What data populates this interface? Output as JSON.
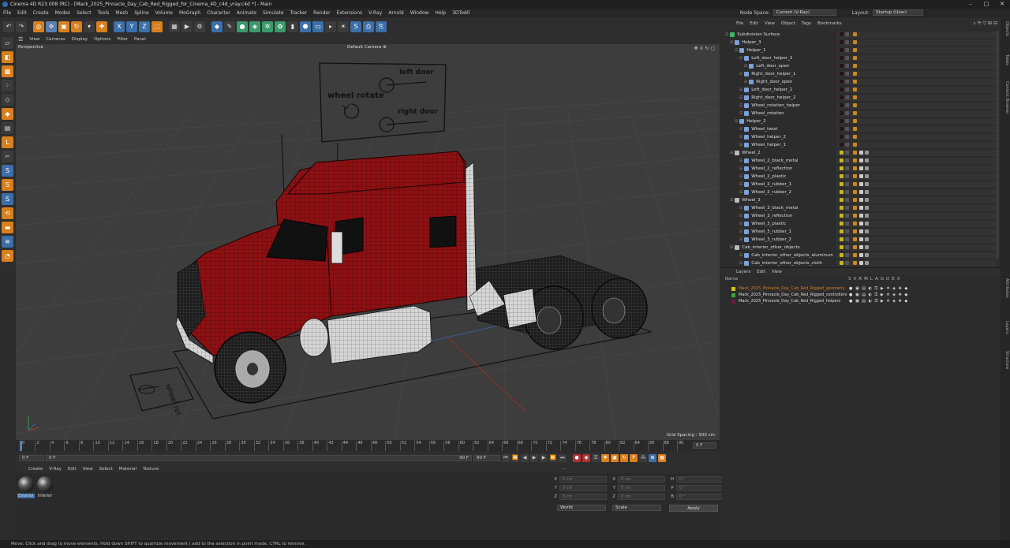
{
  "window": {
    "title": "Cinema 4D R23.008 (RC) - [Mack_2025_Pinnacle_Day_Cab_Red_Rigged_for_Cinema_4D_c4d_vray.c4d *] - Main"
  },
  "menubar": [
    "File",
    "Edit",
    "Create",
    "Modes",
    "Select",
    "Tools",
    "Mesh",
    "Spline",
    "Volume",
    "MoGraph",
    "Character",
    "Animate",
    "Simulate",
    "Tracker",
    "Render",
    "Extensions",
    "V-Ray",
    "Arnold",
    "Window",
    "Help",
    "3DToAll"
  ],
  "node_space": {
    "label": "Node Space:",
    "value": "Current (V-Ray)"
  },
  "layout": {
    "label": "Layout:",
    "value": "Startup (User)"
  },
  "viewport": {
    "menu": [
      "View",
      "Cameras",
      "Display",
      "Options",
      "Filter",
      "Panel"
    ],
    "view_name": "Perspective",
    "camera": "Default Camera",
    "grid_spacing": "Grid Spacing : 500 cm",
    "rig_labels": {
      "wheel_rotate": "wheel rotate",
      "left_door": "left door",
      "right_door": "right door",
      "floor_label": "wheel rot"
    }
  },
  "timeline": {
    "ticks": [
      "0",
      "2",
      "4",
      "6",
      "8",
      "10",
      "12",
      "14",
      "16",
      "18",
      "20",
      "22",
      "24",
      "26",
      "28",
      "30",
      "32",
      "34",
      "36",
      "38",
      "40",
      "42",
      "44",
      "46",
      "48",
      "50",
      "52",
      "54",
      "56",
      "58",
      "60",
      "62",
      "64",
      "66",
      "68",
      "70",
      "72",
      "74",
      "76",
      "78",
      "80",
      "82",
      "84",
      "86",
      "88",
      "90"
    ],
    "current_frame": "0 F"
  },
  "playbar": {
    "start": "0 F",
    "field2": "0 F",
    "end": "90 F",
    "end2": "90 F"
  },
  "materials": {
    "menu": [
      "Create",
      "V-Ray",
      "Edit",
      "View",
      "Select",
      "Material",
      "Texture"
    ],
    "items": [
      {
        "name": "Exterior",
        "selected": true
      },
      {
        "name": "Interior",
        "selected": false
      }
    ]
  },
  "attributes": {
    "rows": [
      {
        "a": "X",
        "av": "0 cm",
        "b": "X",
        "bv": "0 cm",
        "c": "H",
        "cv": "0 °"
      },
      {
        "a": "Y",
        "av": "0 cm",
        "b": "Y",
        "bv": "0 cm",
        "c": "P",
        "cv": "0 °"
      },
      {
        "a": "Z",
        "av": "0 cm",
        "b": "Z",
        "bv": "0 cm",
        "c": "B",
        "cv": "0 °"
      }
    ],
    "coord_mode": "World",
    "scale_mode": "Scale",
    "apply": "Apply"
  },
  "objects": {
    "menu": [
      "File",
      "Edit",
      "View",
      "Object",
      "Tags",
      "Bookmarks"
    ],
    "items": [
      {
        "name": "Subdivision Surface",
        "depth": 0,
        "color": "#3bb86a"
      },
      {
        "name": "Helper_3",
        "depth": 1,
        "color": "#7aa3d6"
      },
      {
        "name": "Helper_1",
        "depth": 2,
        "color": "#7aa3d6"
      },
      {
        "name": "Left_door_helper_2",
        "depth": 3,
        "color": "#7aa3d6"
      },
      {
        "name": "Left_door_open",
        "depth": 4,
        "color": "#7aa3d6"
      },
      {
        "name": "Right_door_helper_1",
        "depth": 3,
        "color": "#7aa3d6"
      },
      {
        "name": "Right_door_open",
        "depth": 4,
        "color": "#7aa3d6"
      },
      {
        "name": "Left_door_helper_1",
        "depth": 3,
        "color": "#7aa3d6"
      },
      {
        "name": "Right_door_helper_2",
        "depth": 3,
        "color": "#7aa3d6"
      },
      {
        "name": "Wheel_rotation_helper",
        "depth": 3,
        "color": "#7aa3d6"
      },
      {
        "name": "Wheel_rotation",
        "depth": 3,
        "color": "#7aa3d6"
      },
      {
        "name": "Helper_2",
        "depth": 2,
        "color": "#7aa3d6"
      },
      {
        "name": "Wheel_twist",
        "depth": 3,
        "color": "#7aa3d6"
      },
      {
        "name": "Wheel_helper_2",
        "depth": 3,
        "color": "#7aa3d6"
      },
      {
        "name": "Wheel_helper_1",
        "depth": 3,
        "color": "#7aa3d6"
      },
      {
        "name": "Wheel_2",
        "depth": 1,
        "color": "#bbbbbb"
      },
      {
        "name": "Wheel_2_black_metal",
        "depth": 3,
        "color": "#7aa3d6"
      },
      {
        "name": "Wheel_2_reflection",
        "depth": 3,
        "color": "#7aa3d6"
      },
      {
        "name": "Wheel_2_plastic",
        "depth": 3,
        "color": "#7aa3d6"
      },
      {
        "name": "Wheel_2_rubber_1",
        "depth": 3,
        "color": "#7aa3d6"
      },
      {
        "name": "Wheel_2_rubber_2",
        "depth": 3,
        "color": "#7aa3d6"
      },
      {
        "name": "Wheel_3",
        "depth": 1,
        "color": "#bbbbbb"
      },
      {
        "name": "Wheel_3_black_metal",
        "depth": 3,
        "color": "#7aa3d6"
      },
      {
        "name": "Wheel_3_reflection",
        "depth": 3,
        "color": "#7aa3d6"
      },
      {
        "name": "Wheel_3_plastic",
        "depth": 3,
        "color": "#7aa3d6"
      },
      {
        "name": "Wheel_3_rubber_1",
        "depth": 3,
        "color": "#7aa3d6"
      },
      {
        "name": "Wheel_3_rubber_2",
        "depth": 3,
        "color": "#7aa3d6"
      },
      {
        "name": "Cab_interior_other_objects",
        "depth": 1,
        "color": "#bbbbbb"
      },
      {
        "name": "Cab_interior_other_objects_aluminum",
        "depth": 3,
        "color": "#7aa3d6"
      },
      {
        "name": "Cab_interior_other_objects_cloth",
        "depth": 3,
        "color": "#7aa3d6"
      }
    ]
  },
  "layers": {
    "menu": [
      "Layers",
      "Edit",
      "View"
    ],
    "header": {
      "name": "Name",
      "cols": [
        "S",
        "V",
        "R",
        "M",
        "L",
        "A",
        "G",
        "D",
        "E",
        "X"
      ]
    },
    "items": [
      {
        "name": "Mack_2025_Pinnacle_Day_Cab_Red_Rigged_geometry",
        "color": "#d4c020",
        "highlight": true
      },
      {
        "name": "Mack_2025_Pinnacle_Day_Cab_Red_Rigged_controllers",
        "color": "#3aa83a",
        "highlight": false
      },
      {
        "name": "Mack_2025_Pinnacle_Day_Cab_Red_Rigged_helpers",
        "color": "#6a1a3a",
        "highlight": false
      }
    ]
  },
  "right_tabs": [
    "Objects",
    "Takes",
    "Content Browser",
    "Attributes",
    "Layers",
    "Structure"
  ],
  "status": "Move: Click and drag to move elements. Hold down SHIFT to quantize movement / add to the selection in point mode, CTRL to remove.",
  "colors": {
    "accent_orange": "#d87f1e",
    "accent_blue": "#3c6fa8",
    "truck_red": "#8c0f12"
  }
}
